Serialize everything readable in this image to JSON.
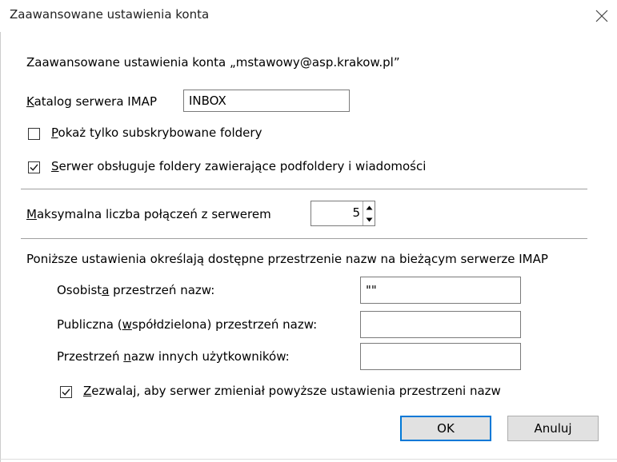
{
  "window": {
    "title": "Zaawansowane ustawienia konta"
  },
  "header": {
    "text": "Zaawansowane ustawienia konta „mstawowy@asp.krakow.pl”"
  },
  "imap": {
    "dir_label_u": "K",
    "dir_label_rest": "atalog serwera IMAP",
    "dir_value": "INBOX"
  },
  "options": {
    "subscribed": {
      "u": "P",
      "rest": "okaż tylko subskrybowane foldery",
      "checked": false
    },
    "server_folders": {
      "u": "S",
      "rest": "erwer obsługuje foldery zawierające podfoldery i wiadomości",
      "checked": true
    }
  },
  "connections": {
    "label_u": "M",
    "label_rest": "aksymalna liczba połączeń z serwerem",
    "value": "5"
  },
  "namespaces": {
    "intro": "Poniższe ustawienia określają dostępne przestrzenie nazw na bieżącym serwerze IMAP",
    "personal": {
      "pre": "Osobist",
      "u": "a",
      "post": " przestrzeń nazw:",
      "value": "\"\""
    },
    "public": {
      "pre": "Publiczna (",
      "u": "w",
      "post": "spółdzielona) przestrzeń nazw:",
      "value": ""
    },
    "other": {
      "pre": "Przestrzeń ",
      "u": "n",
      "post": "azw innych użytkowników:",
      "value": ""
    },
    "allow_override": {
      "u": "Z",
      "rest": "ezwalaj, aby serwer zmieniał powyższe ustawienia przestrzeni nazw",
      "checked": true
    }
  },
  "buttons": {
    "ok": "OK",
    "cancel": "Anuluj"
  },
  "colors": {
    "accent": "#0078d7",
    "button_bg": "#e1e1e1"
  }
}
